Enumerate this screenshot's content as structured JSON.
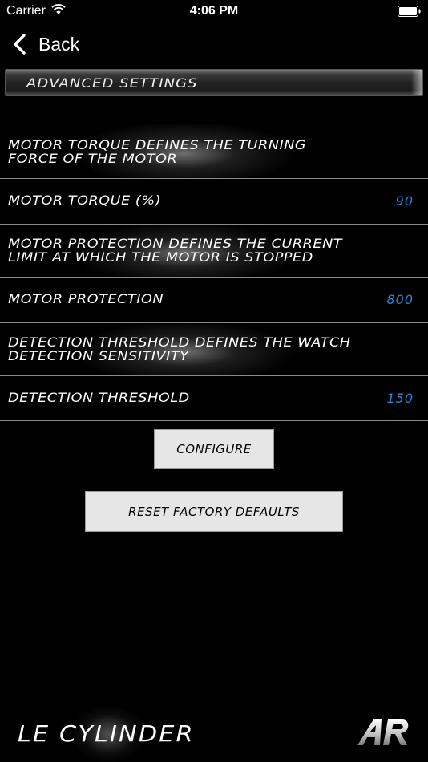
{
  "status_bar": {
    "carrier": "Carrier",
    "time": "4:06 PM"
  },
  "nav": {
    "back_label": "Back"
  },
  "section": {
    "title": "ADVANCED SETTINGS"
  },
  "rows": [
    {
      "text": "MOTOR TORQUE DEFINES THE TURNING\nFORCE OF THE MOTOR"
    },
    {
      "text": "MOTOR TORQUE (%)",
      "value": "90"
    },
    {
      "text": "MOTOR PROTECTION DEFINES THE CURRENT\nLIMIT AT WHICH THE MOTOR IS STOPPED"
    },
    {
      "text": "MOTOR PROTECTION",
      "value": "800"
    },
    {
      "text": "DETECTION THRESHOLD DEFINES THE WATCH\nDETECTION SENSITIVITY"
    },
    {
      "text": "DETECTION THRESHOLD",
      "value": "150"
    }
  ],
  "buttons": {
    "configure": "CONFIGURE",
    "reset": "RESET FACTORY DEFAULTS"
  },
  "footer": {
    "brand": "LE CYLINDER"
  },
  "colors": {
    "value_blue": "#2e86d6",
    "background": "#000000",
    "button_bg": "#e6e6e6"
  },
  "icons": {
    "wifi": "wifi-icon",
    "battery": "battery-icon",
    "back": "chevron-left-icon",
    "logo": "ar-logo-icon"
  }
}
